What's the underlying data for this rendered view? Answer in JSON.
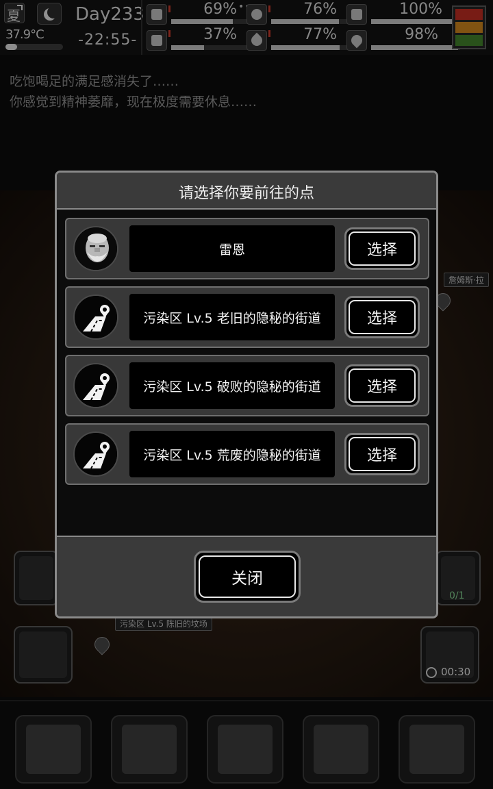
{
  "status": {
    "season": "夏",
    "temperature": "37.9°C",
    "temperature_fraction": 0.2,
    "day": "Day233",
    "clock": "-22:55-",
    "more": "•••",
    "stats": [
      {
        "icon": "medkit-icon",
        "value": "69%",
        "fraction": 0.69
      },
      {
        "icon": "stomach-icon",
        "value": "76%",
        "fraction": 0.76
      },
      {
        "icon": "energy-icon",
        "value": "100%",
        "fraction": 1.0
      },
      {
        "icon": "foot-icon",
        "value": "37%",
        "fraction": 0.37
      },
      {
        "icon": "water-drop-icon",
        "value": "77%",
        "fraction": 0.77
      },
      {
        "icon": "heart-icon",
        "value": "98%",
        "fraction": 0.98
      }
    ],
    "alert_colors": [
      "#b92b21",
      "#c7801c",
      "#3f7d2a"
    ]
  },
  "messages": [
    "吃饱喝足的满足感消失了……",
    "你感觉到精神萎靡，现在极度需要休息……"
  ],
  "map": {
    "label_top": "詹姆斯·拉",
    "label_bottom": "污染区 Lv.5 陈旧的坟场",
    "counter": "0/1",
    "timer": "00:30"
  },
  "dialog": {
    "title": "请选择你要前往的点",
    "destinations": [
      {
        "name": "雷恩",
        "select_label": "选择",
        "icon": "old-man-portrait-icon"
      },
      {
        "name": "污染区 Lv.5 老旧的隐秘的街道",
        "select_label": "选择",
        "icon": "road-pin-icon"
      },
      {
        "name": "污染区 Lv.5 破败的隐秘的街道",
        "select_label": "选择",
        "icon": "road-pin-icon"
      },
      {
        "name": "污染区 Lv.5 荒废的隐秘的街道",
        "select_label": "选择",
        "icon": "road-pin-icon"
      }
    ],
    "close_label": "关闭"
  },
  "bottom_nav": [
    {
      "icon": "backpack-icon"
    },
    {
      "icon": "brain-head-icon"
    },
    {
      "icon": "notebook-icon"
    },
    {
      "icon": "shopping-cart-icon"
    },
    {
      "icon": "menu-list-icon"
    }
  ]
}
